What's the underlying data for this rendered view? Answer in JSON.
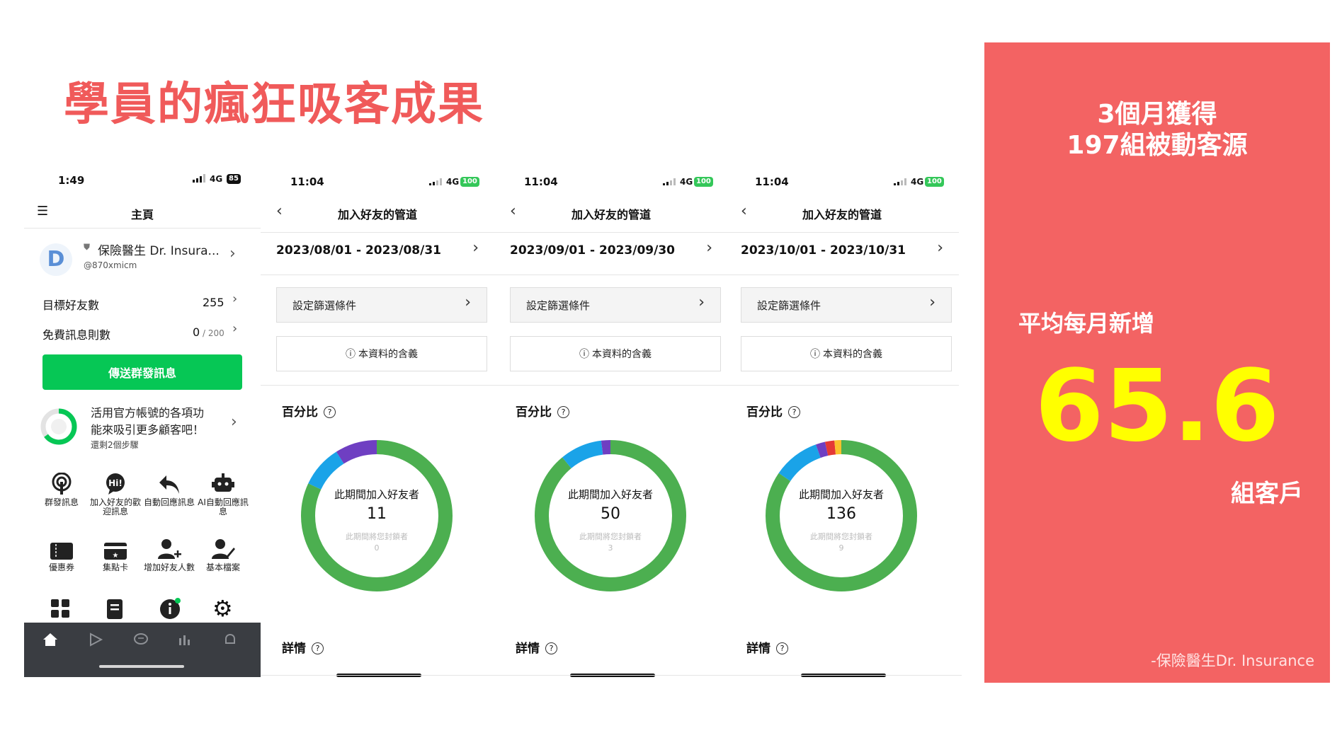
{
  "title": "學員的瘋狂吸客成果",
  "home_phone": {
    "time": "1:49",
    "net": "4G",
    "battery": "85",
    "header": "主頁",
    "account_name": "保險醫生 Dr. Insura...",
    "account_id": "@870xmicm",
    "stats": [
      {
        "label": "目標好友數",
        "value": "255",
        "sub": ""
      },
      {
        "label": "免費訊息則數",
        "value": "0",
        "sub": " / 200"
      }
    ],
    "broadcast_button": "傳送群發訊息",
    "promo_line1": "活用官方帳號的各項功",
    "promo_line2": "能來吸引更多顧客吧！",
    "promo_steps": "還剩2個步驟",
    "grid": [
      {
        "label": "群發訊息",
        "icon": "broadcast-icon"
      },
      {
        "label": "加入好友的歡迎訊息",
        "icon": "hi-bubble-icon"
      },
      {
        "label": "自動回應訊息",
        "icon": "reply-arrow-icon"
      },
      {
        "label": "AI自動回應訊息",
        "icon": "robot-icon"
      },
      {
        "label": "優惠券",
        "icon": "coupon-icon"
      },
      {
        "label": "集點卡",
        "icon": "point-card-icon"
      },
      {
        "label": "增加好友人數",
        "icon": "add-friend-icon"
      },
      {
        "label": "基本檔案",
        "icon": "profile-icon"
      }
    ]
  },
  "stat_phones": [
    {
      "time": "11:04",
      "net": "4G",
      "battery": "100",
      "header": "加入好友的管道",
      "date_range": "2023/08/01 - 2023/08/31",
      "filter": "設定篩選條件",
      "info": "本資料的含義",
      "percent_label": "百分比",
      "center_label": "此期間加入好友者",
      "center_value": "11",
      "blocked_label": "此期間將您封鎖者",
      "blocked_value": "0",
      "details_label": "詳情"
    },
    {
      "time": "11:04",
      "net": "4G",
      "battery": "100",
      "header": "加入好友的管道",
      "date_range": "2023/09/01 - 2023/09/30",
      "filter": "設定篩選條件",
      "info": "本資料的含義",
      "percent_label": "百分比",
      "center_label": "此期間加入好友者",
      "center_value": "50",
      "blocked_label": "此期間將您封鎖者",
      "blocked_value": "3",
      "details_label": "詳情"
    },
    {
      "time": "11:04",
      "net": "4G",
      "battery": "100",
      "header": "加入好友的管道",
      "date_range": "2023/10/01 - 2023/10/31",
      "filter": "設定篩選條件",
      "info": "本資料的含義",
      "percent_label": "百分比",
      "center_label": "此期間加入好友者",
      "center_value": "136",
      "blocked_label": "此期間將您封鎖者",
      "blocked_value": "9",
      "details_label": "詳情"
    }
  ],
  "chart_data": [
    {
      "type": "pie",
      "slices": [
        {
          "value": 0.82,
          "color": "#4caf50"
        },
        {
          "value": 0.09,
          "color": "#1aa3e8"
        },
        {
          "value": 0.09,
          "color": "#6f3fc2"
        }
      ]
    },
    {
      "type": "pie",
      "slices": [
        {
          "value": 0.89,
          "color": "#4caf50"
        },
        {
          "value": 0.09,
          "color": "#1aa3e8"
        },
        {
          "value": 0.02,
          "color": "#6f3fc2"
        }
      ]
    },
    {
      "type": "pie",
      "slices": [
        {
          "value": 0.845,
          "color": "#4caf50"
        },
        {
          "value": 0.1,
          "color": "#1aa3e8"
        },
        {
          "value": 0.02,
          "color": "#6f3fc2"
        },
        {
          "value": 0.02,
          "color": "#e53935"
        },
        {
          "value": 0.015,
          "color": "#fbc02d"
        }
      ]
    }
  ],
  "panel": {
    "line1": "3個月獲得",
    "line2": "197組被動客源",
    "avg_label": "平均每月新增",
    "avg_value": "65.6",
    "unit": "組客戶",
    "credit": "-保險醫生Dr. Insurance"
  },
  "colors": {
    "title": "#f05a5a",
    "panel": "#f36363",
    "highlight": "#ffff00",
    "line_green": "#06c755"
  }
}
